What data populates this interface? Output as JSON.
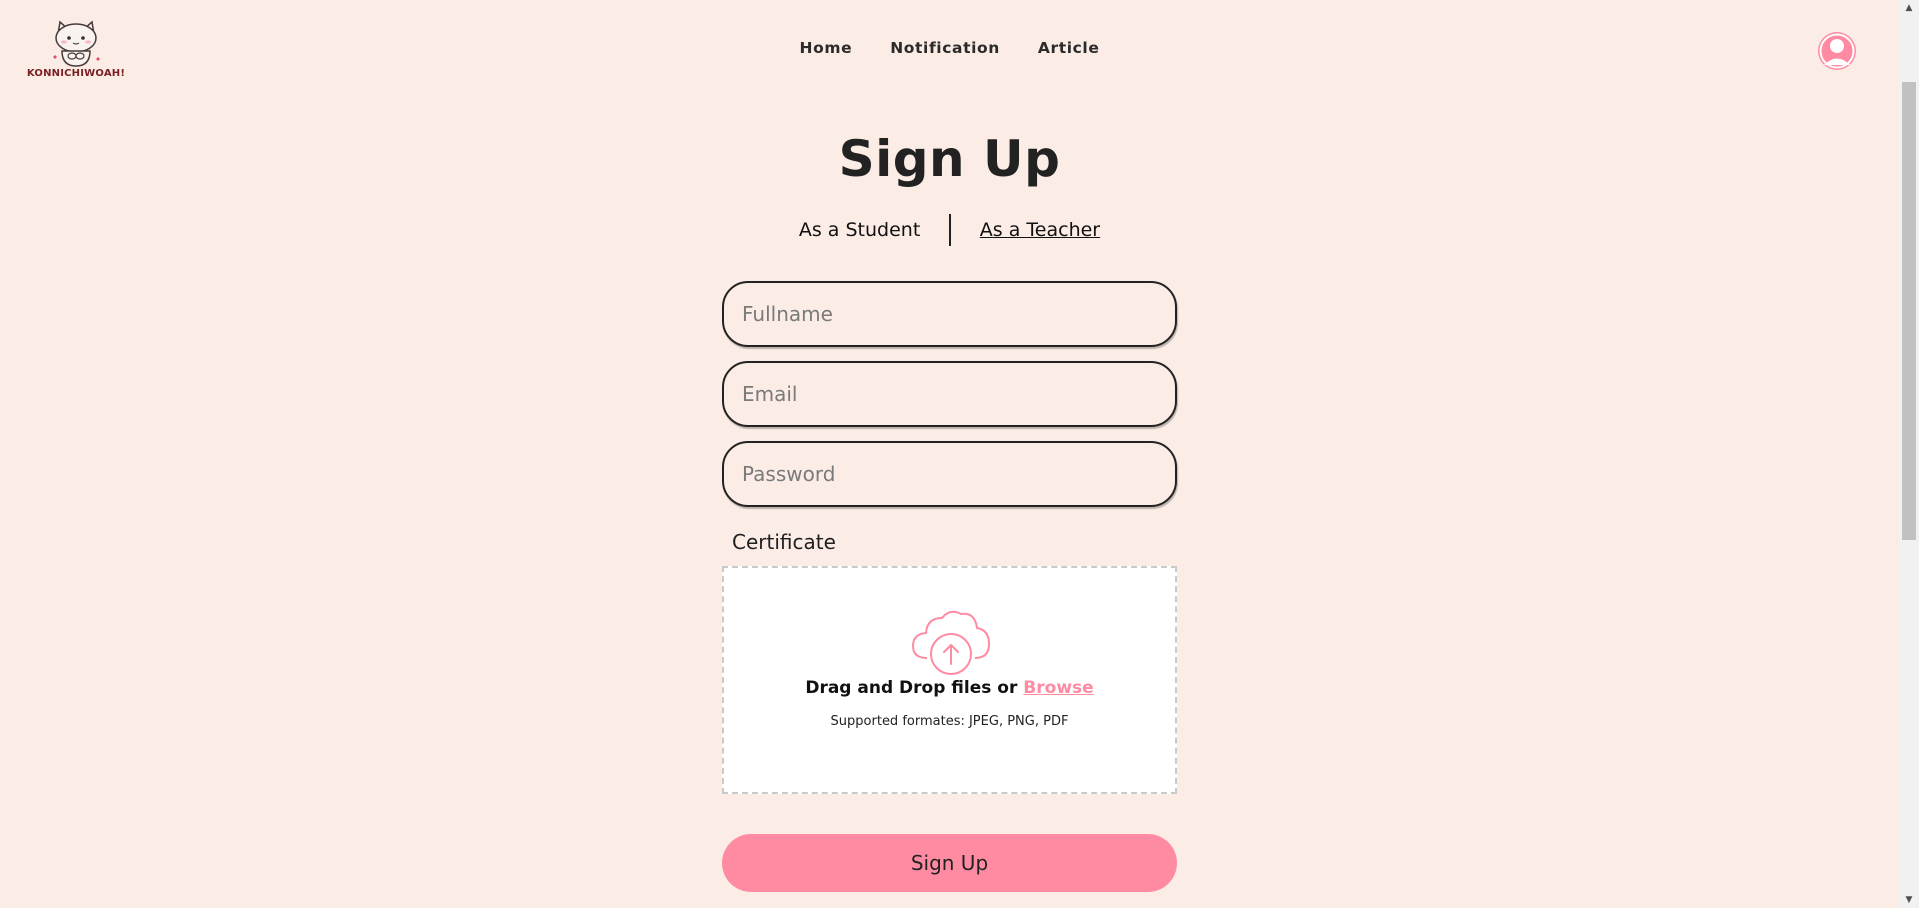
{
  "header": {
    "logo_text": "KONNICHIWOAH!",
    "nav": [
      "Home",
      "Notification",
      "Article"
    ]
  },
  "page": {
    "title": "Sign Up",
    "roles": {
      "student": "As a Student",
      "teacher": "As a Teacher"
    }
  },
  "form": {
    "fullname_placeholder": "Fullname",
    "email_placeholder": "Email",
    "password_placeholder": "Password",
    "certificate_label": "Certificate",
    "drop_text": "Drag and Drop files or",
    "browse_label": "Browse",
    "supported_formats": "Supported formates: JPEG, PNG, PDF",
    "submit_label": "Sign Up"
  },
  "colors": {
    "background": "#fbece5",
    "accent_pink": "#ff8ba3",
    "text_dark": "#222222"
  },
  "icons": {
    "logo": "cat-mascot-icon",
    "avatar": "user-avatar-icon",
    "upload": "cloud-upload-icon"
  }
}
